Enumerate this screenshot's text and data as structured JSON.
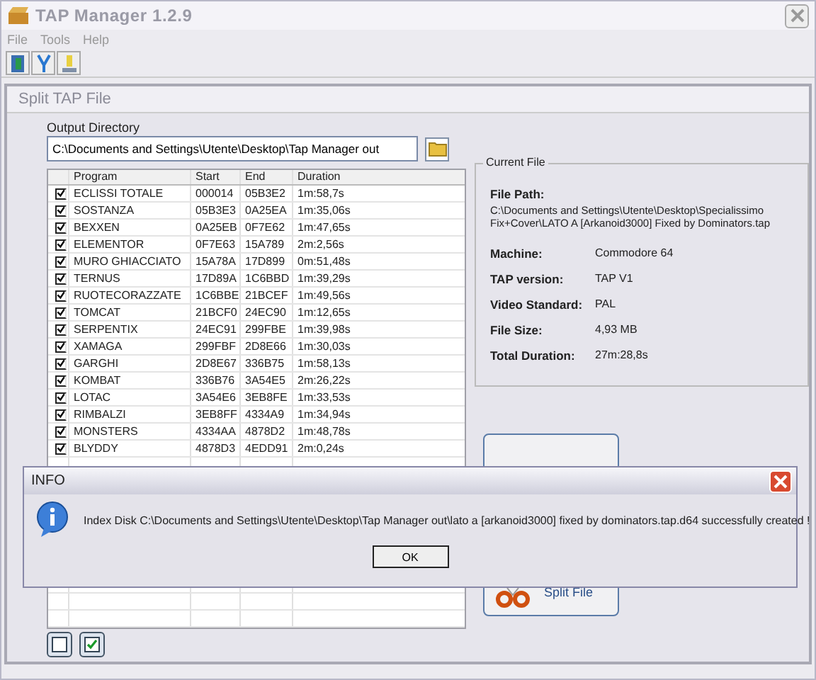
{
  "window": {
    "title": "TAP Manager 1.2.9"
  },
  "menu": [
    "File",
    "Tools",
    "Help"
  ],
  "panel": {
    "title": "Split TAP File"
  },
  "output_directory": {
    "label": "Output Directory",
    "value": "C:\\Documents and Settings\\Utente\\Desktop\\Tap Manager out"
  },
  "table": {
    "columns": [
      "Program",
      "Start",
      "End",
      "Duration"
    ],
    "rows": [
      {
        "checked": true,
        "cells": [
          "ECLISSI TOTALE",
          "000014",
          "05B3E2",
          "1m:58,7s"
        ]
      },
      {
        "checked": true,
        "cells": [
          "SOSTANZA",
          "05B3E3",
          "0A25EA",
          "1m:35,06s"
        ]
      },
      {
        "checked": true,
        "cells": [
          "BEXXEN",
          "0A25EB",
          "0F7E62",
          "1m:47,65s"
        ]
      },
      {
        "checked": true,
        "cells": [
          "ELEMENTOR",
          "0F7E63",
          "15A789",
          "2m:2,56s"
        ]
      },
      {
        "checked": true,
        "cells": [
          "MURO GHIACCIATO",
          "15A78A",
          "17D899",
          "0m:51,48s"
        ]
      },
      {
        "checked": true,
        "cells": [
          "TERNUS",
          "17D89A",
          "1C6BBD",
          "1m:39,29s"
        ]
      },
      {
        "checked": true,
        "cells": [
          "RUOTECORAZZATE",
          "1C6BBE",
          "21BCEF",
          "1m:49,56s"
        ]
      },
      {
        "checked": true,
        "cells": [
          "TOMCAT",
          "21BCF0",
          "24EC90",
          "1m:12,65s"
        ]
      },
      {
        "checked": true,
        "cells": [
          "SERPENTIX",
          "24EC91",
          "299FBE",
          "1m:39,98s"
        ]
      },
      {
        "checked": true,
        "cells": [
          "XAMAGA",
          "299FBF",
          "2D8E66",
          "1m:30,03s"
        ]
      },
      {
        "checked": true,
        "cells": [
          "GARGHI",
          "2D8E67",
          "336B75",
          "1m:58,13s"
        ]
      },
      {
        "checked": true,
        "cells": [
          "KOMBAT",
          "336B76",
          "3A54E5",
          "2m:26,22s"
        ]
      },
      {
        "checked": true,
        "cells": [
          "LOTAC",
          "3A54E6",
          "3EB8FE",
          "1m:33,53s"
        ]
      },
      {
        "checked": true,
        "cells": [
          "RIMBALZI",
          "3EB8FF",
          "4334A9",
          "1m:34,94s"
        ]
      },
      {
        "checked": true,
        "cells": [
          "MONSTERS",
          "4334AA",
          "4878D2",
          "1m:48,78s"
        ]
      },
      {
        "checked": true,
        "cells": [
          "BLYDDY",
          "4878D3",
          "4EDD91",
          "2m:0,24s"
        ]
      }
    ]
  },
  "current_file": {
    "title": "Current File",
    "path_label": "File Path:",
    "path": "C:\\Documents and Settings\\Utente\\Desktop\\Specialissimo Fix+Cover\\LATO A [Arkanoid3000] Fixed by Dominators.tap",
    "fields": [
      {
        "label": "Machine:",
        "value": "Commodore 64"
      },
      {
        "label": "TAP version:",
        "value": "TAP V1"
      },
      {
        "label": "Video Standard:",
        "value": "PAL"
      },
      {
        "label": "File Size:",
        "value": "4,93 MB"
      },
      {
        "label": "Total Duration:",
        "value": "27m:28,8s"
      }
    ]
  },
  "split_button": {
    "label": "Split File"
  },
  "dialog": {
    "title": "INFO",
    "message": "Index Disk C:\\Documents and Settings\\Utente\\Desktop\\Tap Manager out\\lato a [arkanoid3000] fixed by dominators.tap.d64 successfully created !",
    "button": "OK"
  }
}
